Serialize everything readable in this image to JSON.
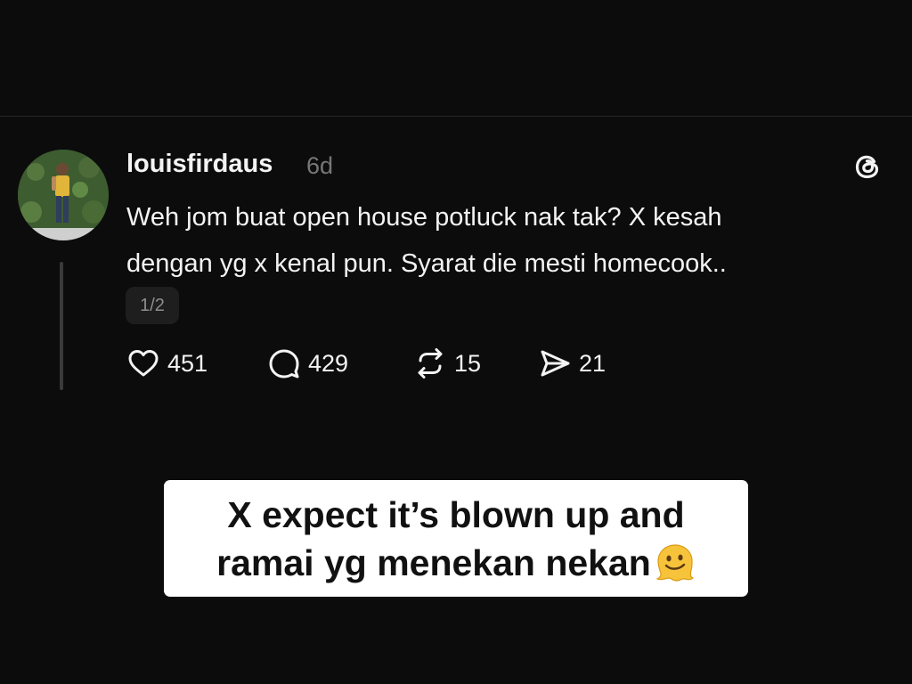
{
  "post": {
    "username": "louisfirdaus",
    "timestamp": "6d",
    "text_lines": [
      "Weh jom buat open house potluck nak tak? X kesah",
      "dengan yg x kenal pun. Syarat die mesti homecook.."
    ],
    "page_indicator": "1/2",
    "actions": {
      "likes": "451",
      "replies": "429",
      "reposts": "15",
      "shares": "21"
    }
  },
  "caption": {
    "lines": [
      "X expect it’s blown up and",
      "ramai yg menekan nekan"
    ],
    "emoji": "melting-face-emoji"
  },
  "icons": {
    "app": "threads-logo-icon",
    "like": "heart-icon",
    "reply": "comment-bubble-icon",
    "repost": "repost-icon",
    "share": "send-icon"
  },
  "colors": {
    "background": "#0c0c0c",
    "text": "#f3f3f3",
    "muted": "#777777",
    "caption_bg": "#ffffff"
  }
}
